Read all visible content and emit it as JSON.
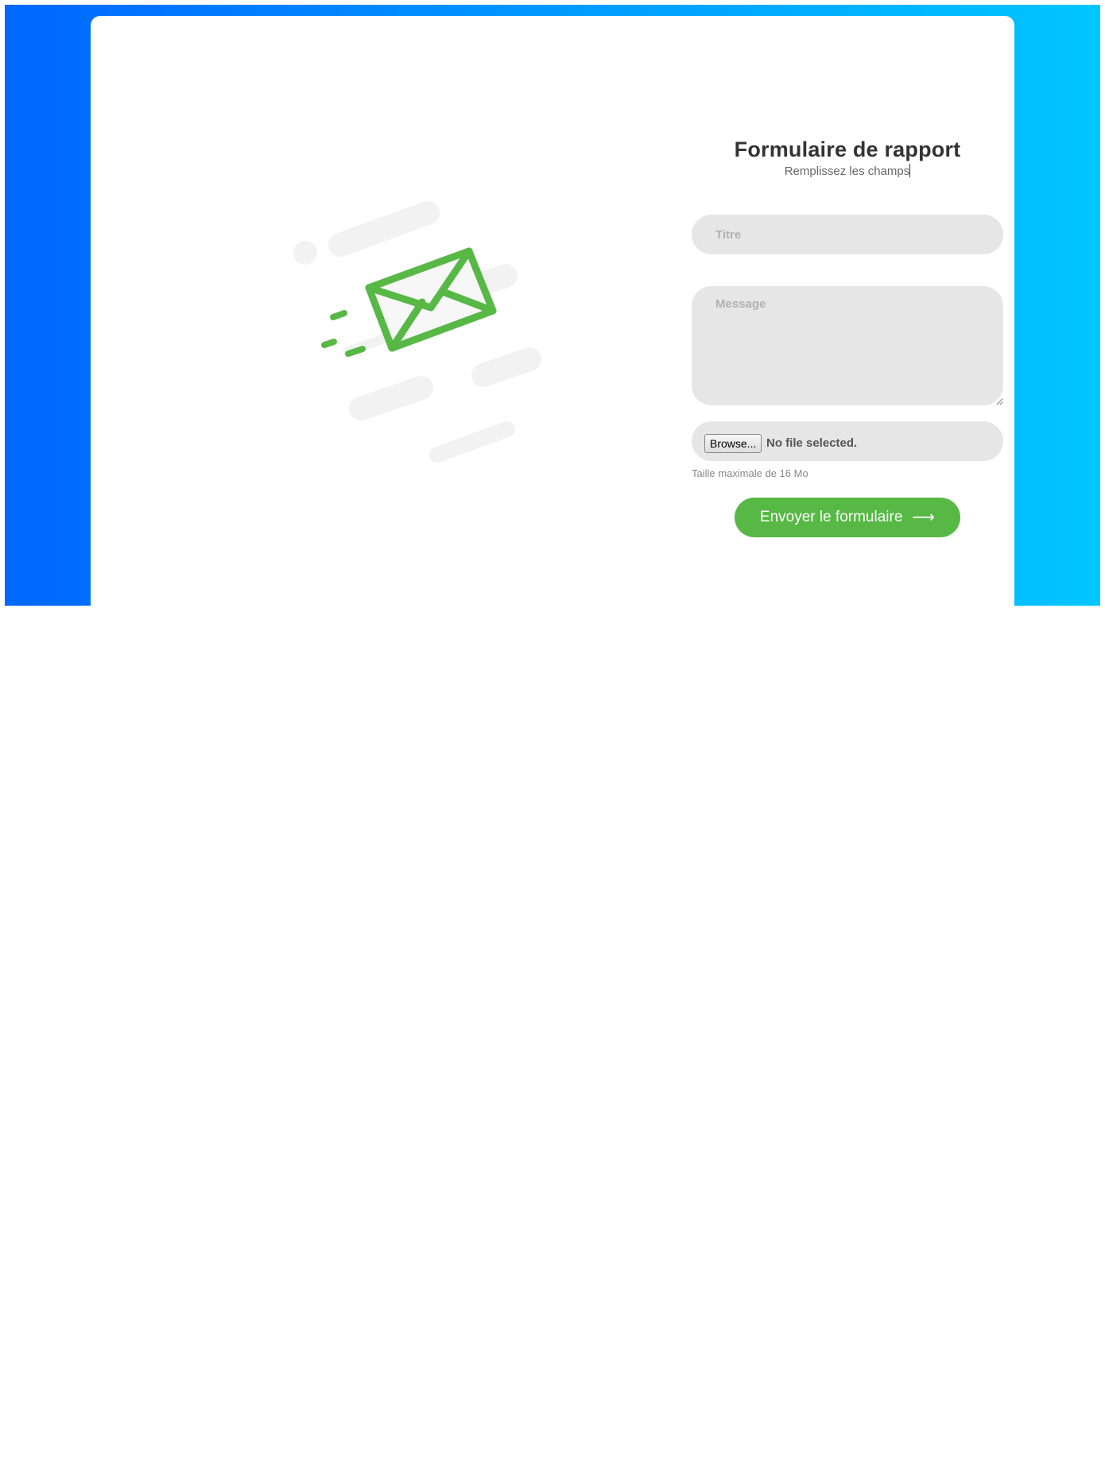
{
  "form": {
    "title": "Formulaire de rapport",
    "subtitle": "Remplissez les champs",
    "title_placeholder": "Titre",
    "title_value": "",
    "message_placeholder": "Message",
    "message_value": "",
    "browse_label": "Browse...",
    "file_status": "No file selected.",
    "max_size_hint": "Taille maximale de 16 Mo",
    "submit_label": "Envoyer le formulaire",
    "submit_icon": "arrow-right-icon"
  },
  "illustration": {
    "icon": "envelope-icon"
  },
  "colors": {
    "gradient_start": "#0066ff",
    "gradient_end": "#00c6ff",
    "accent_green": "#57b846",
    "field_bg": "#e6e6e6",
    "title_text": "#333333"
  }
}
